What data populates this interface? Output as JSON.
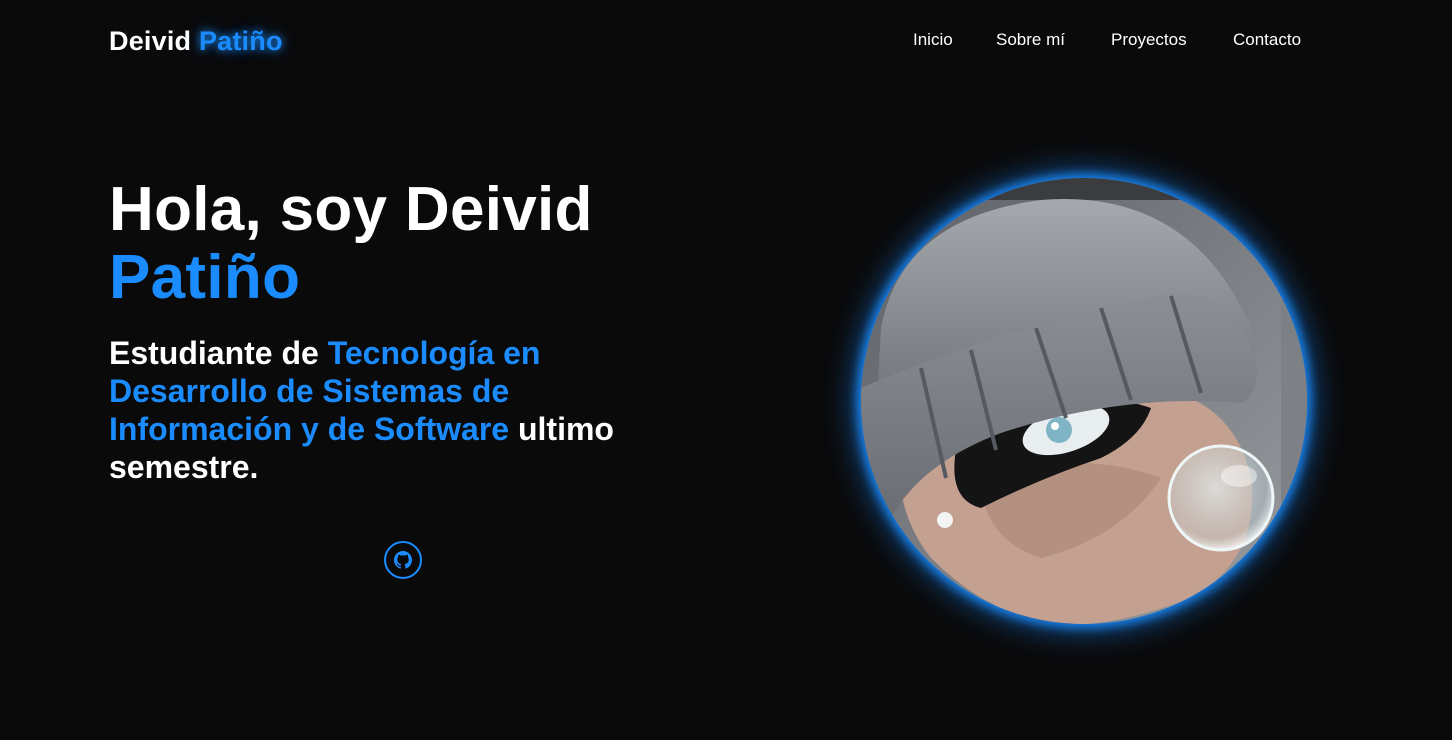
{
  "header": {
    "logo_first": "Deivid",
    "logo_accent": "Patiño"
  },
  "nav": {
    "items": [
      {
        "label": "Inicio"
      },
      {
        "label": "Sobre mí"
      },
      {
        "label": "Proyectos"
      },
      {
        "label": "Contacto"
      }
    ]
  },
  "hero": {
    "title_line1": "Hola, soy Deivid",
    "title_line2": "Patiño",
    "subtitle_prefix": "Estudiante de",
    "subtitle_accent": "Tecnología en Desarrollo de Sistemas de Información y de Software",
    "subtitle_suffix": "ultimo semestre."
  },
  "social": {
    "github_icon": "github-icon"
  },
  "colors": {
    "background": "#0a0a0b",
    "accent": "#1a8cff",
    "text": "#ffffff"
  }
}
